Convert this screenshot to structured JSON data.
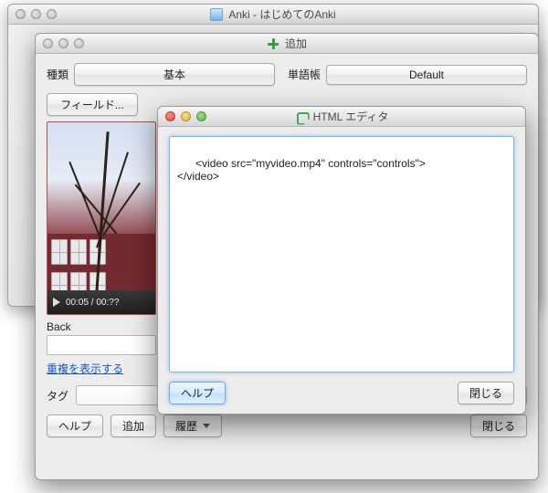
{
  "main_window": {
    "title": "Anki - はじめてのAnki"
  },
  "add_window": {
    "title": "追加",
    "type_label": "種類",
    "type_value": "基本",
    "deck_label": "単語帳",
    "deck_value": "Default",
    "fields_button": "フィールド...",
    "video_time": "00:05 / 00:??",
    "back_label": "Back",
    "show_duplicates": "重複を表示する",
    "tag_label": "タグ",
    "help_button": "ヘルプ",
    "add_button": "追加",
    "history_button": "履歴",
    "close_button": "閉じる"
  },
  "editor_window": {
    "title": "HTML エディタ",
    "content": "<video src=\"myvideo.mp4\" controls=\"controls\">\n</video>",
    "help_button": "ヘルプ",
    "close_button": "閉じる"
  }
}
